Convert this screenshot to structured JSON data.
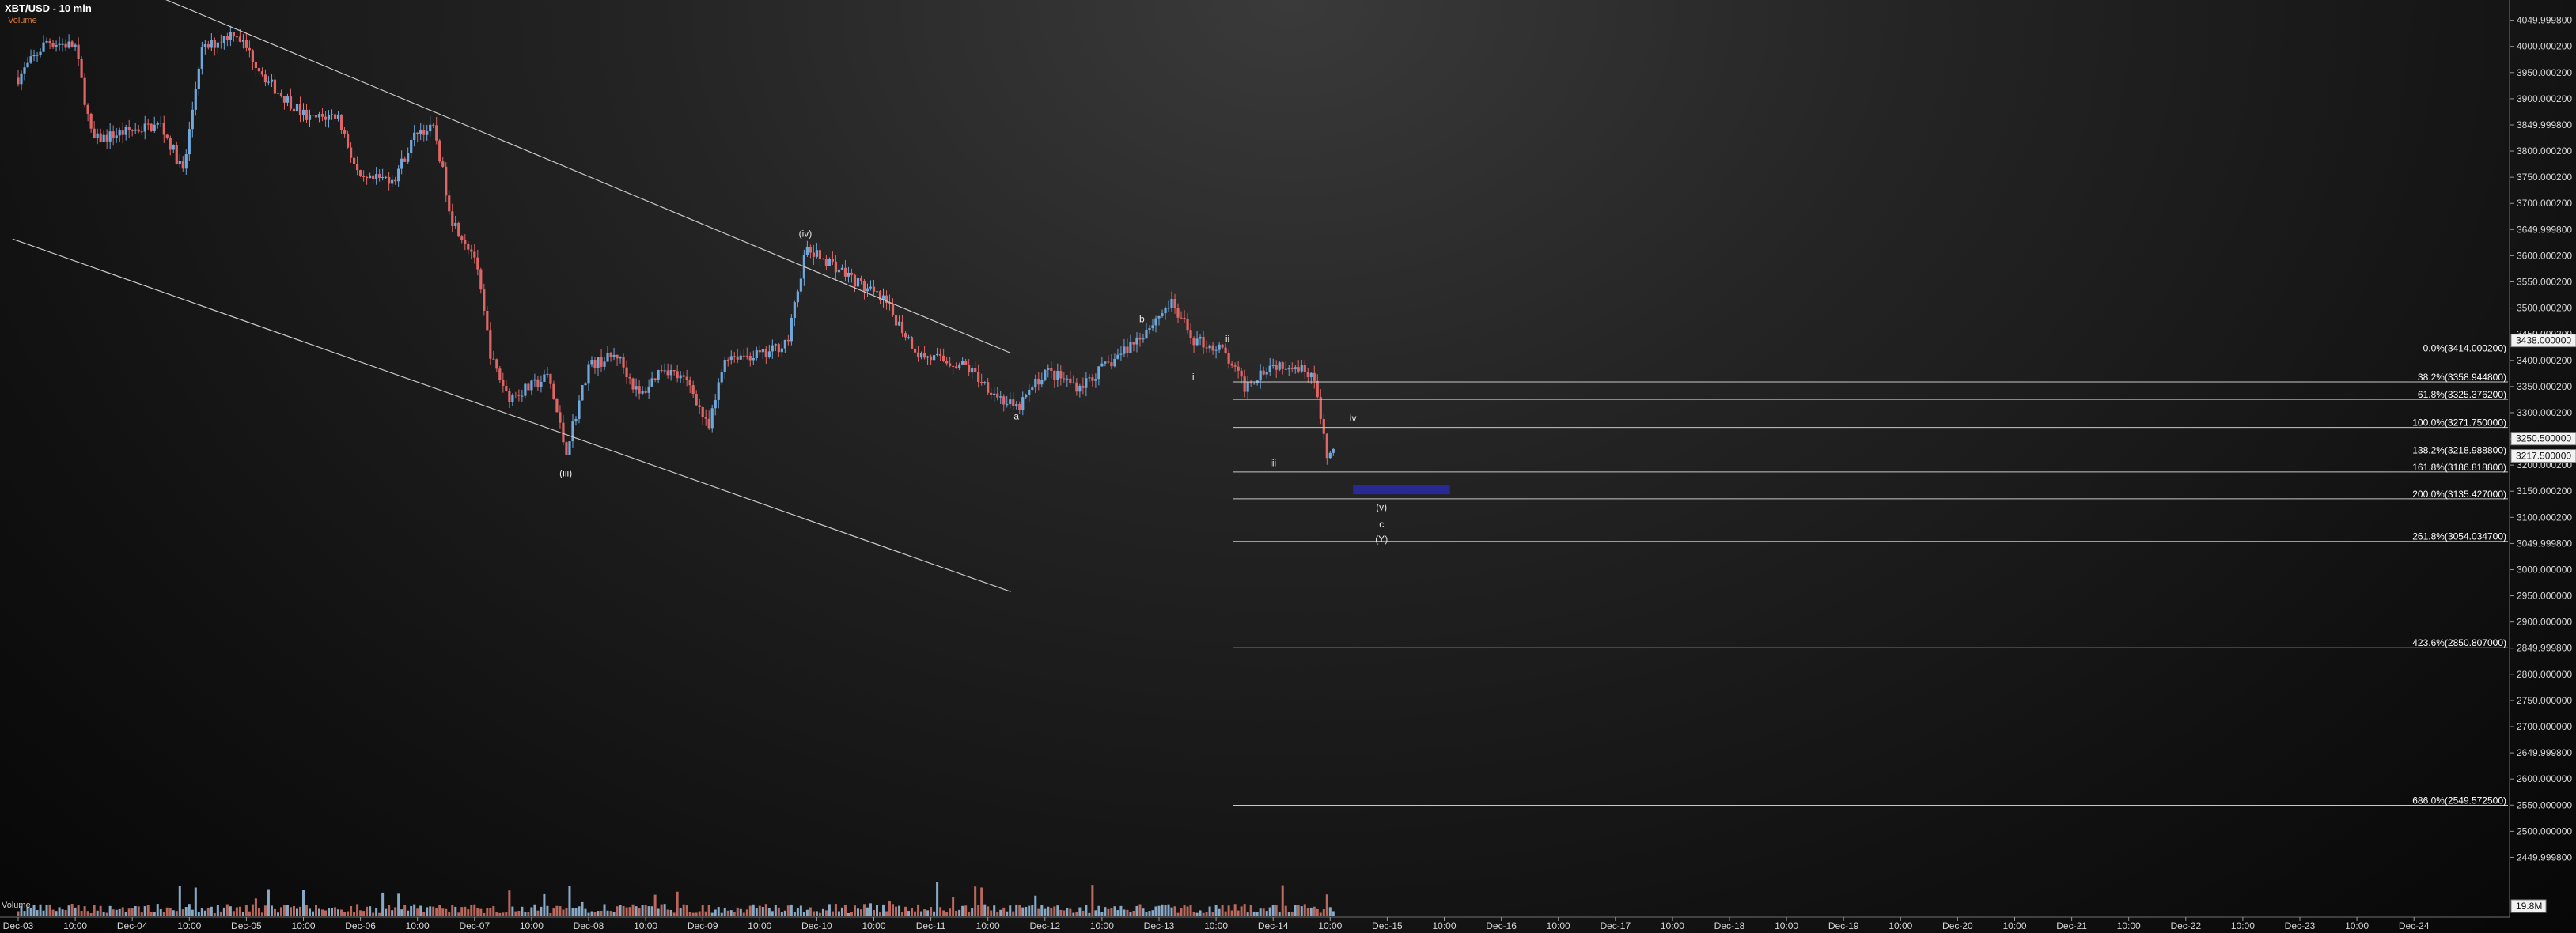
{
  "header": {
    "title": "XBT/USD - 10 min",
    "subtitle": "Volume"
  },
  "volume": {
    "label": "Volume",
    "badge": "19.8M"
  },
  "chart_data": {
    "type": "candlestick",
    "symbol": "XBT/USD",
    "interval": "10 min",
    "x_ticks": [
      "Dec-03",
      "10:00",
      "Dec-04",
      "10:00",
      "Dec-05",
      "10:00",
      "Dec-06",
      "10:00",
      "Dec-07",
      "10:00",
      "Dec-08",
      "10:00",
      "Dec-09",
      "10:00",
      "Dec-10",
      "10:00",
      "Dec-11",
      "10:00",
      "Dec-12",
      "10:00",
      "Dec-13",
      "10:00",
      "Dec-14",
      "10:00",
      "Dec-15",
      "10:00",
      "Dec-16",
      "10:00",
      "Dec-17",
      "10:00",
      "Dec-18",
      "10:00",
      "Dec-19",
      "10:00",
      "Dec-20",
      "10:00",
      "Dec-21",
      "10:00",
      "Dec-22",
      "10:00",
      "Dec-23",
      "10:00",
      "Dec-24"
    ],
    "y_ticks": [
      "4049.999800",
      "4000.000200",
      "3950.000200",
      "3900.000200",
      "3849.999800",
      "3800.000200",
      "3750.000200",
      "3700.000200",
      "3649.999800",
      "3600.000200",
      "3550.000200",
      "3500.000200",
      "3450.000200",
      "3400.000200",
      "3350.000200",
      "3300.000200",
      "3250.000200",
      "3200.000200",
      "3150.000200",
      "3100.000200",
      "3049.999800",
      "3000.000000",
      "2950.000000",
      "2900.000000",
      "2849.999800",
      "2800.000000",
      "2750.000000",
      "2700.000000",
      "2649.999800",
      "2600.000000",
      "2550.000000",
      "2500.000000",
      "2449.999800"
    ],
    "y_range": [
      2425,
      4060
    ],
    "price_path": [
      {
        "day": 0.0,
        "price": 3940
      },
      {
        "day": 0.25,
        "price": 4010
      },
      {
        "day": 0.5,
        "price": 4000
      },
      {
        "day": 0.65,
        "price": 3820
      },
      {
        "day": 1.0,
        "price": 3840
      },
      {
        "day": 1.25,
        "price": 3850
      },
      {
        "day": 1.45,
        "price": 3760
      },
      {
        "day": 1.6,
        "price": 3990
      },
      {
        "day": 1.9,
        "price": 4030
      },
      {
        "day": 2.2,
        "price": 3930
      },
      {
        "day": 2.55,
        "price": 3860
      },
      {
        "day": 2.8,
        "price": 3870
      },
      {
        "day": 3.0,
        "price": 3740
      },
      {
        "day": 3.3,
        "price": 3750
      },
      {
        "day": 3.5,
        "price": 3840
      },
      {
        "day": 3.65,
        "price": 3840
      },
      {
        "day": 3.8,
        "price": 3670
      },
      {
        "day": 4.0,
        "price": 3600
      },
      {
        "day": 4.15,
        "price": 3400
      },
      {
        "day": 4.3,
        "price": 3330
      },
      {
        "day": 4.5,
        "price": 3350
      },
      {
        "day": 4.65,
        "price": 3370
      },
      {
        "day": 4.8,
        "price": 3225
      },
      {
        "day": 5.0,
        "price": 3390
      },
      {
        "day": 5.25,
        "price": 3410
      },
      {
        "day": 5.45,
        "price": 3330
      },
      {
        "day": 5.65,
        "price": 3390
      },
      {
        "day": 5.9,
        "price": 3350
      },
      {
        "day": 6.05,
        "price": 3265
      },
      {
        "day": 6.2,
        "price": 3410
      },
      {
        "day": 6.55,
        "price": 3410
      },
      {
        "day": 6.75,
        "price": 3440
      },
      {
        "day": 6.9,
        "price": 3610
      },
      {
        "day": 7.1,
        "price": 3590
      },
      {
        "day": 7.35,
        "price": 3550
      },
      {
        "day": 7.6,
        "price": 3510
      },
      {
        "day": 7.9,
        "price": 3410
      },
      {
        "day": 8.3,
        "price": 3390
      },
      {
        "day": 8.6,
        "price": 3330
      },
      {
        "day": 8.75,
        "price": 3305
      },
      {
        "day": 9.0,
        "price": 3380
      },
      {
        "day": 9.3,
        "price": 3350
      },
      {
        "day": 9.6,
        "price": 3400
      },
      {
        "day": 9.85,
        "price": 3450
      },
      {
        "day": 10.1,
        "price": 3510
      },
      {
        "day": 10.3,
        "price": 3440
      },
      {
        "day": 10.55,
        "price": 3420
      },
      {
        "day": 10.75,
        "price": 3350
      },
      {
        "day": 10.95,
        "price": 3390
      },
      {
        "day": 11.15,
        "price": 3395
      },
      {
        "day": 11.35,
        "price": 3375
      },
      {
        "day": 11.47,
        "price": 3215
      },
      {
        "day": 11.55,
        "price": 3230
      }
    ],
    "trend_channel": [
      {
        "p1": {
          "day": 1.2,
          "price": 4098
        },
        "p2": {
          "day": 8.7,
          "price": 3414
        }
      },
      {
        "p1": {
          "day": -0.05,
          "price": 3632
        },
        "p2": {
          "day": 8.7,
          "price": 2958
        }
      }
    ],
    "fibonacci_levels": [
      {
        "label": "0.0%(3414.000200)",
        "price": 3414.0002
      },
      {
        "label": "38.2%(3358.944800)",
        "price": 3358.9448
      },
      {
        "label": "61.8%(3325.376200)",
        "price": 3325.3762
      },
      {
        "label": "100.0%(3271.750000)",
        "price": 3271.75
      },
      {
        "label": "138.2%(3218.988800)",
        "price": 3218.9888
      },
      {
        "label": "161.8%(3186.818800)",
        "price": 3186.8188
      },
      {
        "label": "200.0%(3135.427000)",
        "price": 3135.427
      },
      {
        "label": "261.8%(3054.034700)",
        "price": 3054.0347
      },
      {
        "label": "423.6%(2850.807000)",
        "price": 2850.807
      },
      {
        "label": "686.0%(2549.572500)",
        "price": 2549.5725
      }
    ],
    "price_badges": [
      {
        "label": "3438.000000",
        "price": 3438.0
      },
      {
        "label": "3250.500000",
        "price": 3250.5
      },
      {
        "label": "3217.500000",
        "price": 3217.5
      }
    ],
    "wave_labels": [
      {
        "text": "(iii)",
        "day": 4.8,
        "price": 3178
      },
      {
        "text": "(iv)",
        "day": 6.9,
        "price": 3636
      },
      {
        "text": "a",
        "day": 8.75,
        "price": 3287
      },
      {
        "text": "b",
        "day": 9.85,
        "price": 3473
      },
      {
        "text": "i",
        "day": 10.3,
        "price": 3363
      },
      {
        "text": "ii",
        "day": 10.6,
        "price": 3435
      },
      {
        "text": "iii",
        "day": 11.0,
        "price": 3198
      },
      {
        "text": "iv",
        "day": 11.7,
        "price": 3283
      },
      {
        "text": "(v)",
        "day": 11.95,
        "price": 3113
      },
      {
        "text": "c",
        "day": 11.95,
        "price": 3081
      },
      {
        "text": "(Y)",
        "day": 11.95,
        "price": 3052
      }
    ],
    "target_zone": {
      "day_start": 11.7,
      "day_end": 12.55,
      "price_high": 3162,
      "price_low": 3144,
      "color": "#2a2aa8"
    },
    "colors": {
      "up": "#6fa8dc",
      "down": "#e06666",
      "lines": "#c8c8c8",
      "axis_text": "#d8d8d8"
    }
  }
}
